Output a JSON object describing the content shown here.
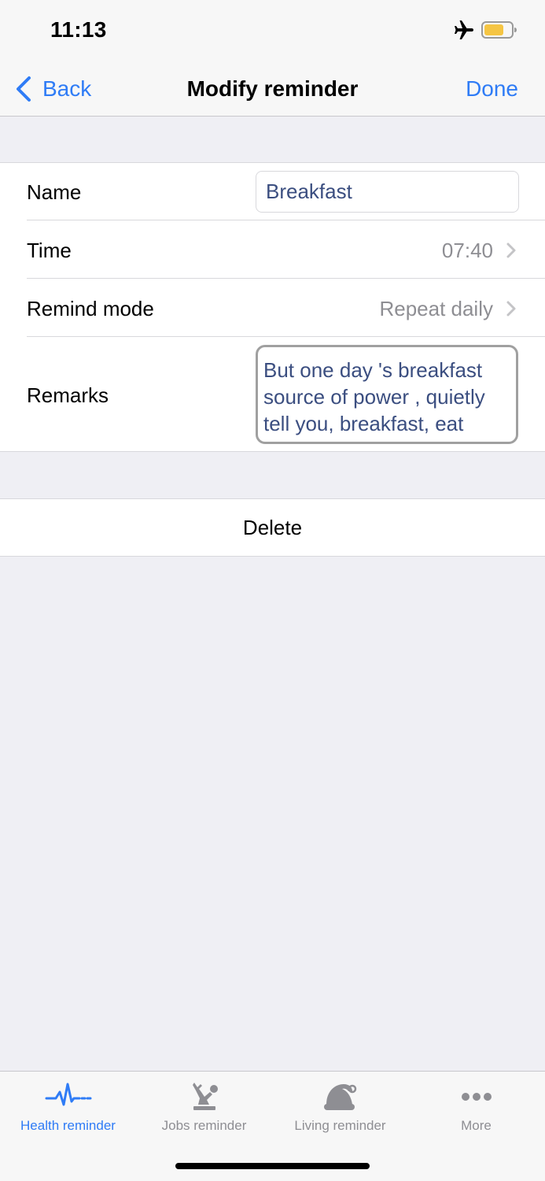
{
  "status_bar": {
    "time": "11:13"
  },
  "nav": {
    "back_label": "Back",
    "title": "Modify reminder",
    "done_label": "Done"
  },
  "form": {
    "name_label": "Name",
    "name_value": "Breakfast",
    "time_label": "Time",
    "time_value": "07:40",
    "remind_mode_label": "Remind mode",
    "remind_mode_value": "Repeat daily",
    "remarks_label": "Remarks",
    "remarks_value": "But one day 's breakfast source of power , quietly tell you, breakfast, eat"
  },
  "delete_label": "Delete",
  "tabs": [
    {
      "label": "Health reminder",
      "icon": "heartbeat-icon",
      "active": true
    },
    {
      "label": "Jobs reminder",
      "icon": "worker-icon",
      "active": false
    },
    {
      "label": "Living reminder",
      "icon": "santa-hat-icon",
      "active": false
    },
    {
      "label": "More",
      "icon": "more-dots-icon",
      "active": false
    }
  ],
  "colors": {
    "accent": "#2f7cf6",
    "input_text": "#3b4e80",
    "secondary_text": "#8e8e93",
    "background": "#efeff4",
    "battery_fill": "#f5c543"
  }
}
